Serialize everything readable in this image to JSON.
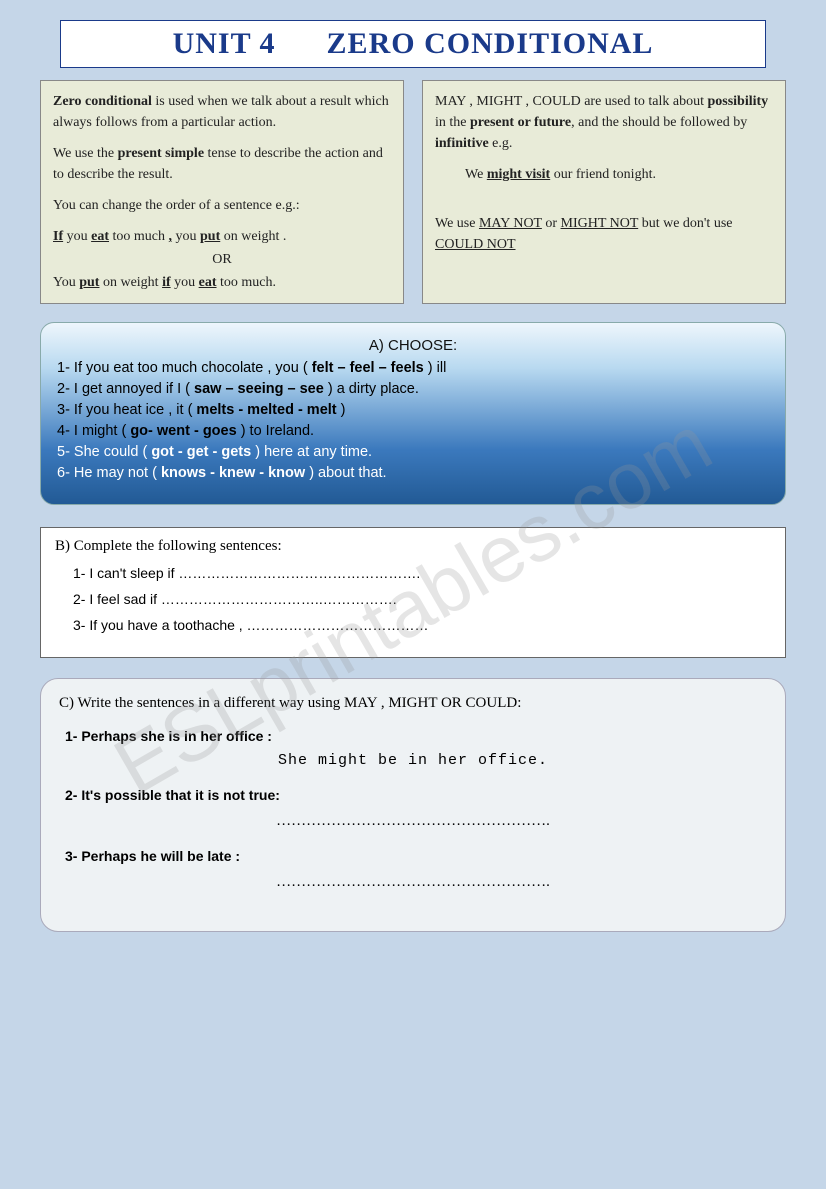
{
  "watermark": "ESLprintables.com",
  "title": {
    "unit": "UNIT 4",
    "topic": "ZERO CONDITIONAL"
  },
  "boxLeft": {
    "p1a": "Zero conditional",
    "p1b": " is used when we talk about a result  which always follows from a particular action.",
    "p2a": "We use the ",
    "p2b": "present simple",
    "p2c": " tense to describe the action and to describe the result.",
    "p3": "You can change the order of a sentence e.g.:",
    "p4": "If you eat too much , you put on weight .",
    "or": "OR",
    "p5": "You put on weight if you eat too much."
  },
  "boxRight": {
    "p1a": "MAY , MIGHT , COULD",
    "p1b": " are used to talk about ",
    "p1c": "possibility",
    "p1d": " in the ",
    "p1e": "present or future",
    "p1f": ", and the should be followed by ",
    "p1g": "infinitive",
    "p1h": " e.g.",
    "ex": "We might visit our friend tonight.",
    "p2a": "We use ",
    "p2b": "MAY NOT",
    "p2c": "  or ",
    "p2d": "MIGHT NOT",
    "p2e": " but we don't use ",
    "p2f": "COULD NOT"
  },
  "sectionA": {
    "head": "A) CHOOSE:",
    "q1": "1- If you eat too much chocolate , you ( felt – feel – feels ) ill",
    "q2": "2- I get annoyed if I ( saw – seeing – see ) a dirty place.",
    "q3": "3- If you heat ice , it ( melts -  melted -  melt )",
    "q4": "4- I might ( go- went -  goes ) to Ireland.",
    "q5": "5- She could ( got -  get -  gets ) here at any time.",
    "q6": "6- He may not ( knows -  knew -  know ) about that."
  },
  "sectionB": {
    "head": "B)  Complete the following sentences:",
    "q1": "1- I can't sleep if …………………………………………….",
    "q2": "2- I feel sad if ……………………………..…………….",
    "q3": "3- If you have a toothache , …………………………………"
  },
  "sectionC": {
    "head": "C)   Write the sentences in a different way using MAY , MIGHT OR COULD:",
    "q1": "1- Perhaps she is in her office :",
    "a1": "She might be in her office.",
    "q2": "2- It's possible that it is not true:",
    "dots": "……………………………………………….",
    "q3": "3- Perhaps he will be late :"
  }
}
